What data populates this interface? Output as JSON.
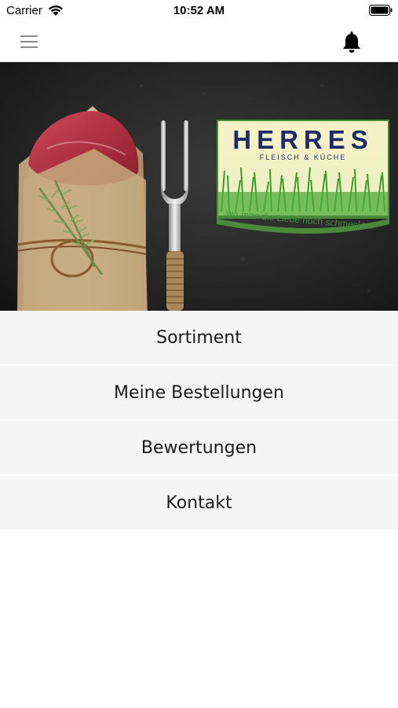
{
  "status_bar": {
    "carrier": "Carrier",
    "time": "10:52 AM"
  },
  "nav": {
    "menu_icon": "hamburger-menu-icon",
    "bell_icon": "bell-icon"
  },
  "banner": {
    "logo_name": "HERRES",
    "logo_subtitle": "FLEISCH & KÜCHE",
    "slogan": "wo man die Liebe noch schmeckt...",
    "colors": {
      "logo_blue": "#1f2a6b",
      "slogan_green": "#3b8f3a",
      "background": "#2a2a2a"
    }
  },
  "menu": {
    "items": [
      {
        "label": "Sortiment"
      },
      {
        "label": "Meine Bestellungen"
      },
      {
        "label": "Bewertungen"
      },
      {
        "label": "Kontakt"
      }
    ]
  }
}
